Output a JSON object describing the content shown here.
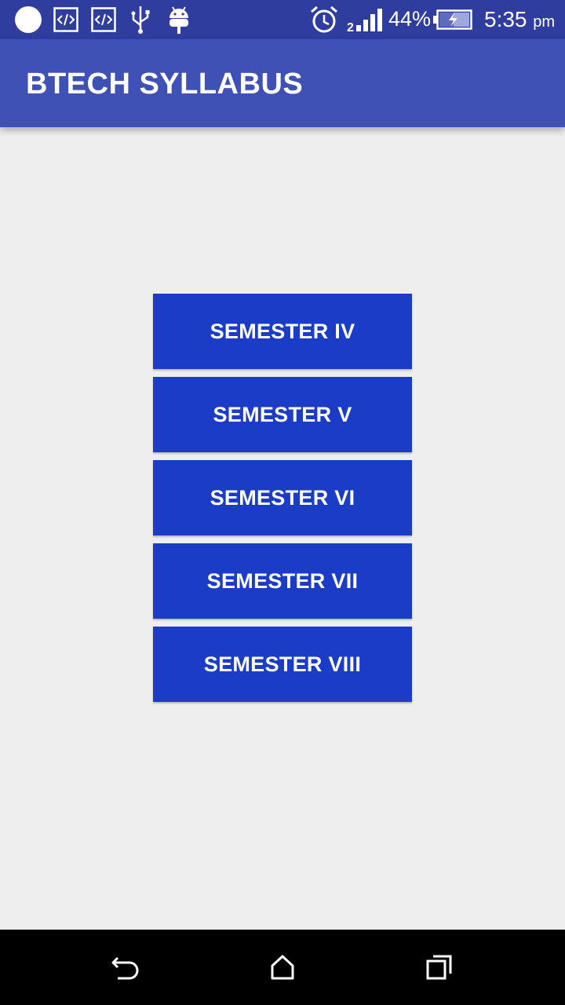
{
  "status_bar": {
    "battery_percent": "44%",
    "time": "5:35",
    "time_suffix": "pm",
    "icons": [
      "notification-dot-icon",
      "code-icon",
      "code-icon",
      "usb-icon",
      "android-debug-icon",
      "alarm-icon",
      "signal-icon",
      "battery-charging-icon"
    ]
  },
  "app_bar": {
    "title": "BTECH SYLLABUS",
    "color": "#3f51b5"
  },
  "semesters": [
    {
      "label": "SEMESTER IV"
    },
    {
      "label": "SEMESTER V"
    },
    {
      "label": "SEMESTER VI"
    },
    {
      "label": "SEMESTER VII"
    },
    {
      "label": "SEMESTER VIII"
    }
  ],
  "colors": {
    "status_bar": "#2f3d9e",
    "button": "#1a3cc7",
    "background": "#eeeeee"
  },
  "nav_bar": {
    "icons": [
      "back-icon",
      "home-icon",
      "recents-icon"
    ]
  }
}
